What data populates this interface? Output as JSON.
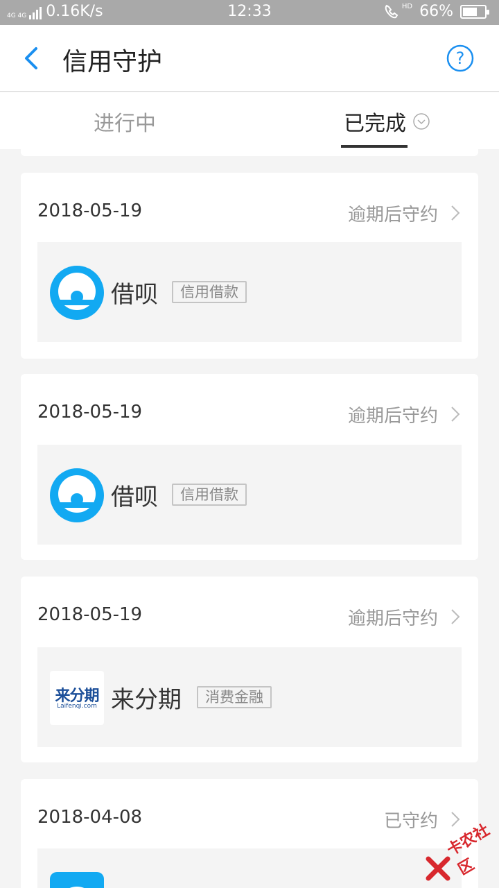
{
  "status_bar": {
    "network": "4G 4G",
    "speed": "0.16K/s",
    "time": "12:33",
    "hd": "HD",
    "battery": "66%",
    "battery_level": 0.66
  },
  "header": {
    "title": "信用守护"
  },
  "tabs": [
    {
      "label": "进行中"
    },
    {
      "label": "已完成"
    }
  ],
  "records": [
    {
      "date": "2018-05-19",
      "status": "逾期后守约",
      "name": "借呗",
      "tag": "信用借款",
      "logo": "jiebei-logo"
    },
    {
      "date": "2018-05-19",
      "status": "逾期后守约",
      "name": "借呗",
      "tag": "信用借款",
      "logo": "jiebei-logo"
    },
    {
      "date": "2018-05-19",
      "status": "逾期后守约",
      "name": "来分期",
      "tag": "消费金融",
      "logo": "laifenqi-logo",
      "logo_text": "来分期",
      "logo_subtext": "Laifenqi.com"
    },
    {
      "date": "2018-04-08",
      "status": "已守约",
      "logo": "wifi-app-logo"
    }
  ],
  "watermark": {
    "text": "卡农社区"
  },
  "colors": {
    "accent": "#1a8ff0",
    "jiebei": "#12a9f2",
    "laifenqi": "#1c4f99",
    "watermark": "#d8282e"
  }
}
